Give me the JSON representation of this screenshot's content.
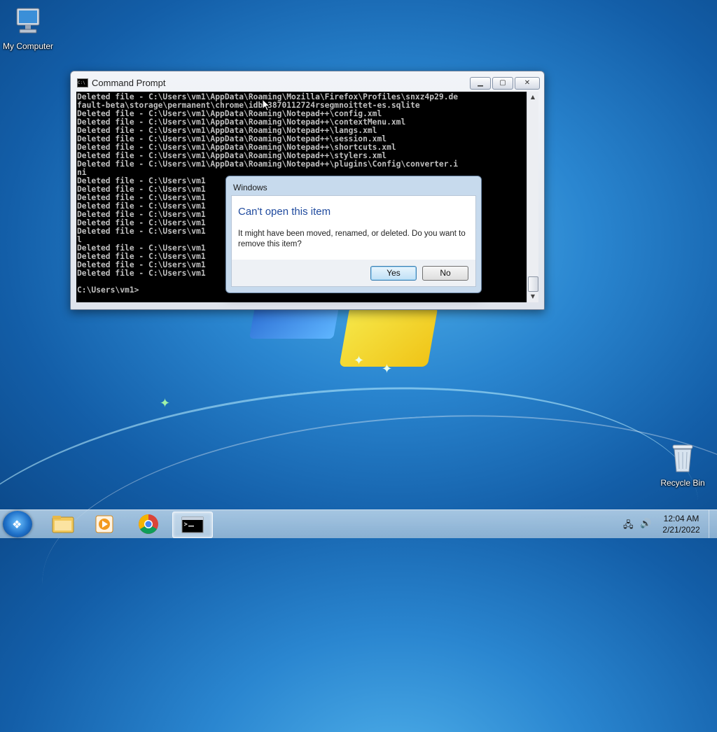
{
  "desktop": {
    "icons": [
      {
        "label": "My Computer",
        "icon": "computer-icon"
      },
      {
        "label": "Recycle Bin",
        "icon": "recycle-bin-icon"
      }
    ]
  },
  "cmd_window": {
    "title": "Command Prompt",
    "console_lines": [
      "Deleted file - C:\\Users\\vm1\\AppData\\Roaming\\Mozilla\\Firefox\\Profiles\\snxz4p29.de",
      "fault-beta\\storage\\permanent\\chrome\\idb\\3870112724rsegmnoittet-es.sqlite",
      "Deleted file - C:\\Users\\vm1\\AppData\\Roaming\\Notepad++\\config.xml",
      "Deleted file - C:\\Users\\vm1\\AppData\\Roaming\\Notepad++\\contextMenu.xml",
      "Deleted file - C:\\Users\\vm1\\AppData\\Roaming\\Notepad++\\langs.xml",
      "Deleted file - C:\\Users\\vm1\\AppData\\Roaming\\Notepad++\\session.xml",
      "Deleted file - C:\\Users\\vm1\\AppData\\Roaming\\Notepad++\\shortcuts.xml",
      "Deleted file - C:\\Users\\vm1\\AppData\\Roaming\\Notepad++\\stylers.xml",
      "Deleted file - C:\\Users\\vm1\\AppData\\Roaming\\Notepad++\\plugins\\Config\\converter.i",
      "ni",
      "Deleted file - C:\\Users\\vm1",
      "Deleted file - C:\\Users\\vm1",
      "Deleted file - C:\\Users\\vm1",
      "Deleted file - C:\\Users\\vm1",
      "Deleted file - C:\\Users\\vm1",
      "Deleted file - C:\\Users\\vm1",
      "Deleted file - C:\\Users\\vm1                                                 A.gov.ur",
      "l",
      "Deleted file - C:\\Users\\vm1                                                 l",
      "Deleted file - C:\\Users\\vm1",
      "Deleted file - C:\\Users\\vm1",
      "Deleted file - C:\\Users\\vm1",
      "",
      "C:\\Users\\vm1>"
    ]
  },
  "dialog": {
    "title": "Windows",
    "heading": "Can't open this item",
    "message": "It might have been moved, renamed, or deleted. Do you want to remove this item?",
    "yes_label": "Yes",
    "no_label": "No"
  },
  "taskbar": {
    "pinned": [
      "file-explorer-icon",
      "media-player-icon",
      "chrome-icon",
      "command-prompt-icon"
    ],
    "active": "command-prompt-icon",
    "tray": [
      "network-icon",
      "volume-icon"
    ],
    "clock": {
      "time": "12:04 AM",
      "date": "2/21/2022"
    }
  },
  "colors": {
    "accent": "#1f4a9e",
    "console_bg": "#000000",
    "console_fg": "#c0c0c0"
  }
}
